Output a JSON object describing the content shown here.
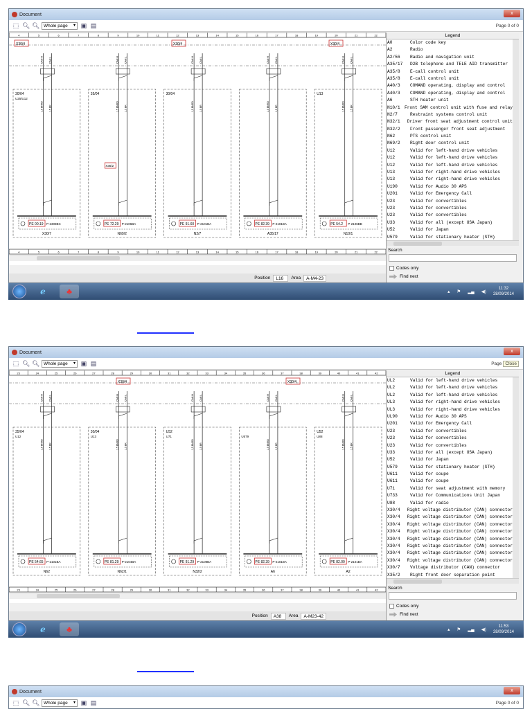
{
  "links": [
    {
      "label": ""
    },
    {
      "label": ""
    }
  ],
  "windows": [
    {
      "title": "Document",
      "zoom_value": "Whole page",
      "page_label": "Page 0 of 0",
      "close_label": "",
      "legend_title": "Legend",
      "legend": [
        [
          "A0",
          "Color code key"
        ],
        [
          "A2",
          "Radio"
        ],
        [
          "A2/56",
          "Radio and navigation unit"
        ],
        [
          "A35/17",
          "D2B telephone and TELE AID transmitter"
        ],
        [
          "A35/8",
          "E-call control unit"
        ],
        [
          "A35/8",
          "E-call control unit"
        ],
        [
          "A40/3",
          "COMAND operating, display and control"
        ],
        [
          "A40/3",
          "COMAND operating, display and control"
        ],
        [
          "A6",
          "STH heater unit"
        ],
        [
          "N10/1",
          "Front SAM control unit with fuse and relay"
        ],
        [
          "N2/7",
          "Restraint systems control unit"
        ],
        [
          "N32/1",
          "Driver front seat adjustment control unit"
        ],
        [
          "N32/2",
          "Front passenger front seat adjustment"
        ],
        [
          "N62",
          "PTS control unit"
        ],
        [
          "N69/2",
          "Right door control unit"
        ],
        [
          "U12",
          "Valid for left-hand drive vehicles"
        ],
        [
          "U12",
          "Valid for left-hand drive vehicles"
        ],
        [
          "U12",
          "Valid for left-hand drive vehicles"
        ],
        [
          "U13",
          "Valid for right-hand drive vehicles"
        ],
        [
          "U13",
          "Valid for right-hand drive vehicles"
        ],
        [
          "U190",
          "Valid for Audio 30 APS"
        ],
        [
          "U201",
          "Valid for Emergency Call"
        ],
        [
          "U23",
          "Valid for convertibles"
        ],
        [
          "U23",
          "Valid for convertibles"
        ],
        [
          "U23",
          "Valid for convertibles"
        ],
        [
          "U33",
          "Valid for all (except USA Japan)"
        ],
        [
          "U52",
          "Valid for Japan"
        ],
        [
          "U579",
          "Valid for stationary heater (STH)"
        ]
      ],
      "search_label": "Search",
      "search_value": "",
      "codes_only_label": "Codes only",
      "find_next_label": "Find next",
      "position_label": "Position",
      "position_value": "L16",
      "area_label": "Area",
      "area_value": "A-M4-23",
      "clock_time": "11:32",
      "clock_date": "28/09/2014",
      "ruler": [
        "4",
        "5",
        "6",
        "7",
        "8",
        "9",
        "10",
        "11",
        "12",
        "13",
        "14",
        "15",
        "16",
        "17",
        "18",
        "19",
        "20",
        "21",
        "22"
      ],
      "connectors": [
        "X30/4",
        "X30/4",
        "X30/4"
      ],
      "modules": [
        {
          "top": "30/04",
          "sub": "U25/U12",
          "pe": "PE 00.19",
          "part": "P-2308BC",
          "name": "X30/7"
        },
        {
          "top": "35/04",
          "sub": "",
          "pe": "PE 72.29",
          "part": "P-2106BA",
          "name": "N69/2",
          "tag": "X35/2"
        },
        {
          "top": "30/04",
          "sub": "",
          "pe": "PE 91.60",
          "part": "P-2101BA",
          "name": "N2/7"
        },
        {
          "top": "",
          "sub": "",
          "pe": "PE 82.39",
          "part": "P-2101BA",
          "name": "A35/17"
        },
        {
          "top": "U13",
          "sub": "",
          "pe": "PE 54.2",
          "part": "P-2106BB",
          "name": "N10/1"
        }
      ]
    },
    {
      "title": "Document",
      "zoom_value": "Whole page",
      "page_label": "Page",
      "close_label": "Close",
      "legend_title": "Legend",
      "legend": [
        [
          "UL2",
          "Valid for left-hand drive vehicles"
        ],
        [
          "UL2",
          "Valid for left-hand drive vehicles"
        ],
        [
          "UL2",
          "Valid for left-hand drive vehicles"
        ],
        [
          "UL3",
          "Valid for right-hand drive vehicles"
        ],
        [
          "UL3",
          "Valid for right-hand drive vehicles"
        ],
        [
          "UL90",
          "Valid for Audio 30 APS"
        ],
        [
          "U201",
          "Valid for Emergency Call"
        ],
        [
          "U23",
          "Valid for convertibles"
        ],
        [
          "U23",
          "Valid for convertibles"
        ],
        [
          "U23",
          "Valid for convertibles"
        ],
        [
          "U33",
          "Valid for all (except USA Japan)"
        ],
        [
          "U52",
          "Valid for Japan"
        ],
        [
          "U579",
          "Valid for stationary heater (STH)"
        ],
        [
          "U611",
          "Valid for coupe"
        ],
        [
          "U611",
          "Valid for coupe"
        ],
        [
          "U71",
          "Valid for seat adjustment with memory"
        ],
        [
          "U733",
          "Valid for Communications Unit Japan"
        ],
        [
          "U88",
          "Valid for radio"
        ],
        [
          "X30/4",
          "Right voltage distributor (CAN) connector"
        ],
        [
          "X30/4",
          "Right voltage distributor (CAN) connector"
        ],
        [
          "X30/4",
          "Right voltage distributor (CAN) connector"
        ],
        [
          "X30/4",
          "Right voltage distributor (CAN) connector"
        ],
        [
          "X30/4",
          "Right voltage distributor (CAN) connector"
        ],
        [
          "X30/4",
          "Right voltage distributor (CAN) connector"
        ],
        [
          "X30/4",
          "Right voltage distributor (CAN) connector"
        ],
        [
          "X30/4",
          "Right voltage distributor (CAN) connector"
        ],
        [
          "X30/7",
          "Voltage distributor (CAN) connector"
        ],
        [
          "X35/2",
          "Right front door separation point"
        ]
      ],
      "search_label": "Search",
      "search_value": "",
      "codes_only_label": "Codes only",
      "find_next_label": "Find next",
      "position_label": "Position",
      "position_value": "A38",
      "area_label": "Area",
      "area_value": "A-M23-42",
      "clock_time": "11:53",
      "clock_date": "28/09/2014",
      "ruler": [
        "23",
        "24",
        "25",
        "26",
        "27",
        "28",
        "29",
        "30",
        "31",
        "32",
        "33",
        "34",
        "35",
        "36",
        "37",
        "38",
        "39",
        "40",
        "41",
        "42"
      ],
      "connectors": [
        "X30/4",
        "X30/4"
      ],
      "modules": [
        {
          "top": "35/04",
          "sub": "U12",
          "pe": "PE 54.65",
          "part": "P-2101BA",
          "name": "N62"
        },
        {
          "top": "30/04",
          "sub": "U13",
          "pe": "PE 81.29",
          "part": "P-2104BA",
          "name": "N62/1"
        },
        {
          "top": "U52",
          "sub": "U71",
          "pe": "PE 91.29",
          "part": "P-2108BA",
          "name": "N32/2"
        },
        {
          "top": "",
          "sub": "U579",
          "pe": "PE 82.39",
          "part": "P-2101BA",
          "name": "A6"
        },
        {
          "top": "U52",
          "sub": "U88",
          "pe": "PE 82.00",
          "part": "P-2101BA",
          "name": "A2"
        }
      ]
    },
    {
      "title": "Document",
      "zoom_value": "Whole page",
      "page_label": "Page 0 of 0",
      "close_label": ""
    }
  ]
}
